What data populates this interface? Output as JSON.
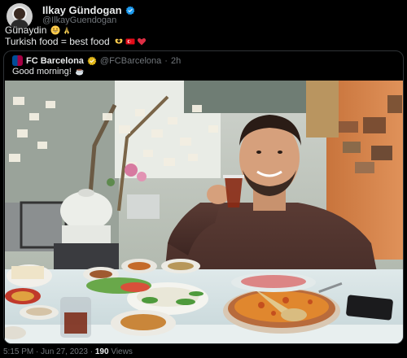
{
  "author": {
    "name": "Ilkay Gündogan",
    "handle": "@IlkayGuendogan",
    "verified": true,
    "verified_icon": "verified-badge-icon",
    "accent": "#1d9bf0"
  },
  "tweet": {
    "line1": "Günaydin",
    "line1_emojis": [
      "grinning-face-emoji",
      "folded-hands-emoji"
    ],
    "line2": "Turkish food = best food",
    "line2_emojis": [
      "heart-hands-emoji",
      "turkey-flag-emoji",
      "red-heart-emoji"
    ]
  },
  "quote": {
    "name": "FC Barcelona",
    "verified_icon": "gold-verified-badge-icon",
    "handle": "@FCBarcelona",
    "separator": "·",
    "time": "2h",
    "text": "Good morning!",
    "text_emoji": "coffee-emoji",
    "photo_alt": "Man smiling raising a tea glass at a breakfast table with Turkish dishes"
  },
  "footer": {
    "timestamp": "5:15 PM · Jun 27, 2023",
    "separator": "·",
    "views_count": "190",
    "views_label": "Views"
  }
}
